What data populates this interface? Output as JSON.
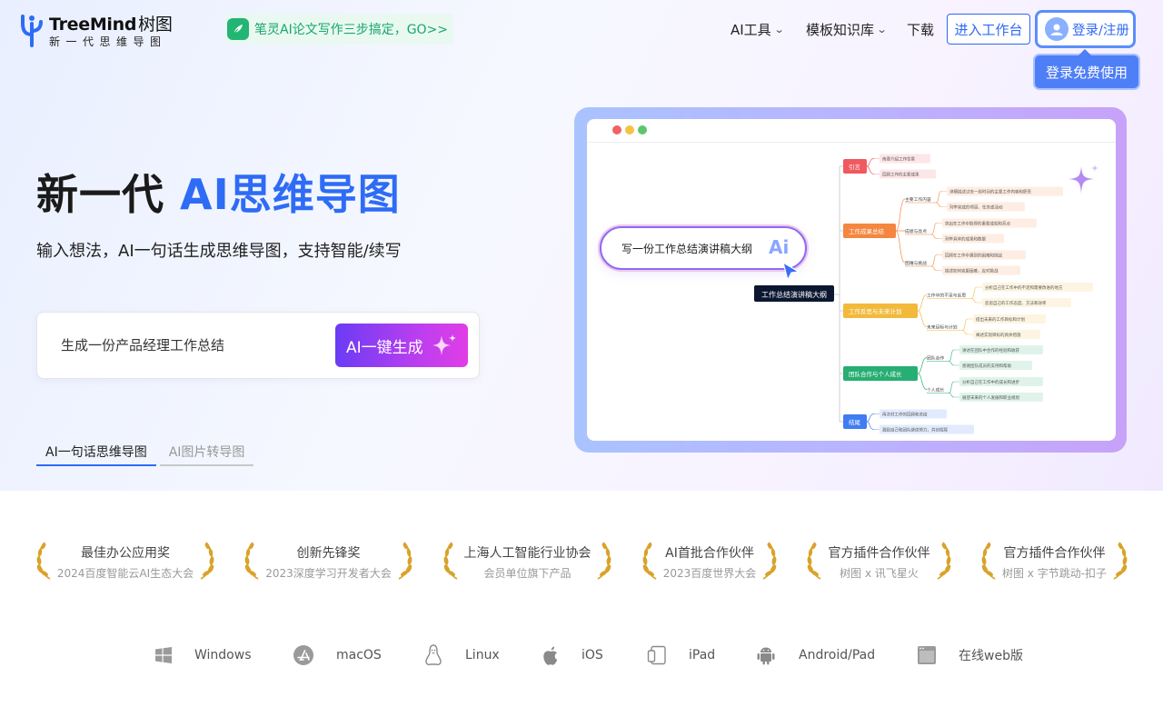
{
  "header": {
    "brand_name": "TreeMind",
    "brand_cn": "树图",
    "slogan": "新一代思维导图",
    "promo": "笔灵AI论文写作三步搞定，GO>>",
    "nav": [
      {
        "label": "AI工具",
        "has_dropdown": true
      },
      {
        "label": "模板知识库",
        "has_dropdown": true
      },
      {
        "label": "下载",
        "has_dropdown": false
      }
    ],
    "workspace_button": "进入工作台",
    "login_button": "登录/注册",
    "login_tooltip": "登录免费使用"
  },
  "hero": {
    "headline_prefix": "新一代 ",
    "headline_accent": "AI思维导图",
    "subline": "输入想法，AI一句话生成思维导图，支持智能/续写",
    "input_placeholder": "生成一份产品经理工作总结",
    "generate_button": "AI一键生成",
    "tabs": [
      {
        "label": "AI一句话思维导图",
        "active": true
      },
      {
        "label": "AI图片转导图",
        "active": false
      }
    ]
  },
  "preview": {
    "prompt": "写一份工作总结演讲稿大纲",
    "prompt_badge": "Ai",
    "root": "工作总结演讲稿大纲",
    "branches": [
      {
        "label": "引言",
        "color": "#f0595f",
        "leaves": [
          "简要介绍工作背景",
          "回顾工作的主要成果"
        ]
      },
      {
        "label": "工作成果总结",
        "color": "#f5863f",
        "groups": [
          {
            "label": "主要工作内容",
            "leaves": [
              "详细描述过去一段时间的主要工作内容和职责",
              "列举完成的项目、任务或活动"
            ]
          },
          {
            "label": "成绩与亮点",
            "leaves": [
              "突出在工作中取得的重要成就和亮点",
              "列举具体的成果和数据"
            ]
          },
          {
            "label": "困难与挑战",
            "leaves": [
              "回顾在工作中遇到的困难和挑战",
              "描述如何克服困难，应对挑战"
            ]
          }
        ]
      },
      {
        "label": "工作反思与未来计划",
        "color": "#f2b93b",
        "groups": [
          {
            "label": "工作中的不足与反思",
            "leaves": [
              "分析自己在工作中的不足和需要改进的地方",
              "反思自己的工作态度、方法和效率"
            ]
          },
          {
            "label": "未来目标与计划",
            "leaves": [
              "提出未来的工作目标和计划",
              "阐述实现目标的具体措施"
            ]
          }
        ]
      },
      {
        "label": "团队合作与个人成长",
        "color": "#27ae72",
        "groups": [
          {
            "label": "团队合作",
            "leaves": [
              "讲述在团队中合作的经验和收获",
              "感谢团队成员的支持和帮助"
            ]
          },
          {
            "label": "个人成长",
            "leaves": [
              "分析自己在工作中的成长和进步",
              "展望未来的个人发展和职业规划"
            ]
          }
        ]
      },
      {
        "label": "结尾",
        "color": "#3f7cf4",
        "leaves": [
          "再次对工作的回顾和总结",
          "激励自己和团队继续努力，共创辉煌"
        ]
      }
    ]
  },
  "awards": [
    {
      "title": "最佳办公应用奖",
      "subtitle": "2024百度智能云AI生态大会"
    },
    {
      "title": "创新先锋奖",
      "subtitle": "2023深度学习开发者大会"
    },
    {
      "title": "上海人工智能行业协会",
      "subtitle": "会员单位旗下产品"
    },
    {
      "title": "AI首批合作伙伴",
      "subtitle": "2023百度世界大会"
    },
    {
      "title": "官方插件合作伙伴",
      "subtitle": "树图 x 讯飞星火"
    },
    {
      "title": "官方插件合作伙伴",
      "subtitle": "树图 x 字节跳动-扣子"
    }
  ],
  "platforms": [
    {
      "label": "Windows",
      "icon": "windows-icon"
    },
    {
      "label": "macOS",
      "icon": "appstore-icon"
    },
    {
      "label": "Linux",
      "icon": "linux-icon"
    },
    {
      "label": "iOS",
      "icon": "apple-icon"
    },
    {
      "label": "iPad",
      "icon": "tablet-icon"
    },
    {
      "label": "Android/Pad",
      "icon": "android-icon"
    },
    {
      "label": "在线web版",
      "icon": "browser-icon"
    }
  ],
  "colors": {
    "brand_blue": "#2e6cf6",
    "promo_green": "#16a86a",
    "gradient_start": "#6a3cf4",
    "gradient_end": "#e13ee6"
  }
}
